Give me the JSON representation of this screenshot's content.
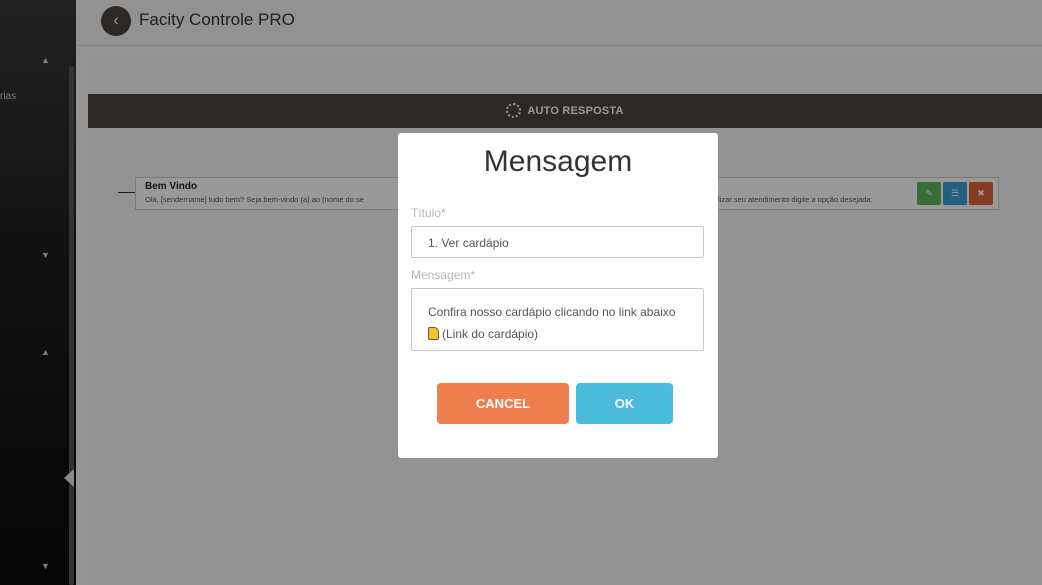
{
  "header": {
    "title": "Facity Controle PRO"
  },
  "sidebar": {
    "partial_label": "rias"
  },
  "section": {
    "title": "AUTO RESPOSTA"
  },
  "entry": {
    "title": "Bem Vindo",
    "text": "Olá, [sendername] tudo bem? Seja bem-vindo (a) ao (nome do se",
    "text_tail": "lizar seu atendimento digite a opção desejada:"
  },
  "modal": {
    "title": "Mensagem",
    "title_label": "Título*",
    "title_value": "1. Ver cardápio",
    "message_label": "Mensagem*",
    "message_line1": "Confira nosso cardápio clicando no link abaixo",
    "message_line2": "(Link do cardápio)",
    "cancel_label": "CANCEL",
    "ok_label": "OK"
  },
  "colors": {
    "bar": "#4a4440",
    "cancel": "#ef7e4f",
    "ok": "#4bbbdc",
    "edit": "#5cb85c",
    "list": "#3a9fd6",
    "delete": "#e2633a"
  }
}
